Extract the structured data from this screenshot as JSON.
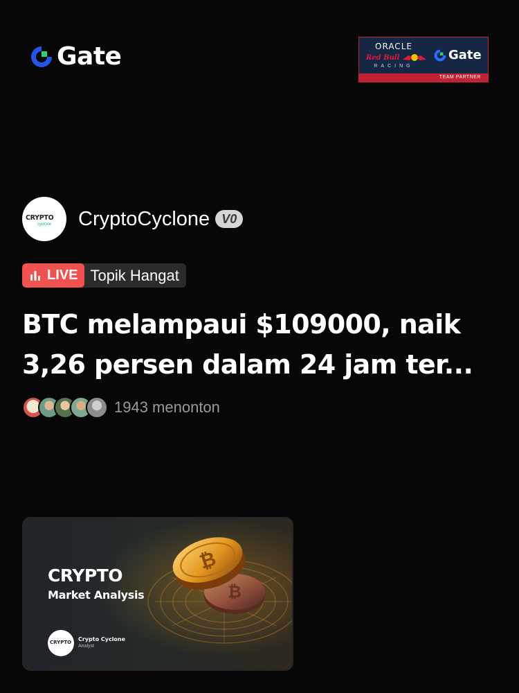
{
  "header": {
    "logo": {
      "text": "Gate",
      "icon": "gate-logo-icon"
    },
    "partner": {
      "oracle": "ORACLE",
      "redbull": "Red Bull",
      "racing": "RACING",
      "gate": "Gate",
      "strip": "TEAM PARTNER",
      "colors": {
        "background": "#152745",
        "accent": "#c22333"
      }
    }
  },
  "author": {
    "name": "CryptoCyclone",
    "badge": "V0",
    "avatar_text": "CRYPTO",
    "avatar_subtext": "cyclone"
  },
  "live": {
    "badge": "LIVE",
    "icon": "bar-chart-icon",
    "topic": "Topik Hangat",
    "color": "#f0524f"
  },
  "headline": {
    "text": "BTC melampaui $109000, naik 3,26 persen dalam 24 jam ter..."
  },
  "viewers": {
    "count_text": "1943 menonton"
  },
  "thumbnail": {
    "title": "CRYPTO",
    "subtitle": "Market Analysis",
    "avatar_text": "CRYPTO",
    "name": "Crypto Cyclone",
    "role": "Analyst"
  }
}
